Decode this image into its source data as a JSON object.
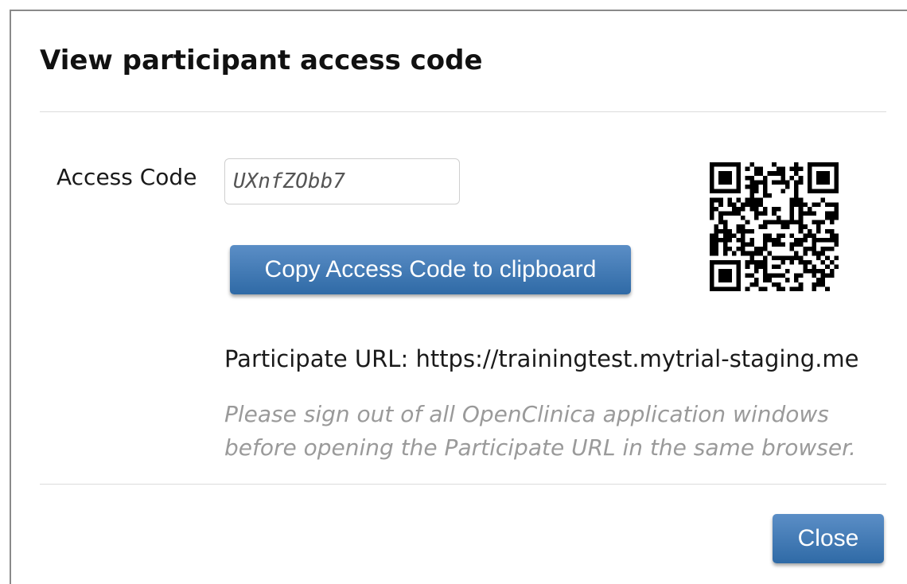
{
  "dialog": {
    "title": "View participant access code",
    "access_code_label": "Access Code",
    "access_code_value": "UXnfZObb7",
    "copy_button_label": "Copy Access Code to clipboard",
    "qr_icon": "qr-code",
    "participate_url_text": "Participate URL: https://trainingtest.mytrial-staging.me",
    "note_line1": "Please sign out of all OpenClinica application windows",
    "note_line2": "before opening the Participate URL in the same browser.",
    "close_button_label": "Close"
  },
  "colors": {
    "button_top": "#5b8ec6",
    "button_bottom": "#2f6aa6",
    "note_text": "#9a9a9a"
  }
}
